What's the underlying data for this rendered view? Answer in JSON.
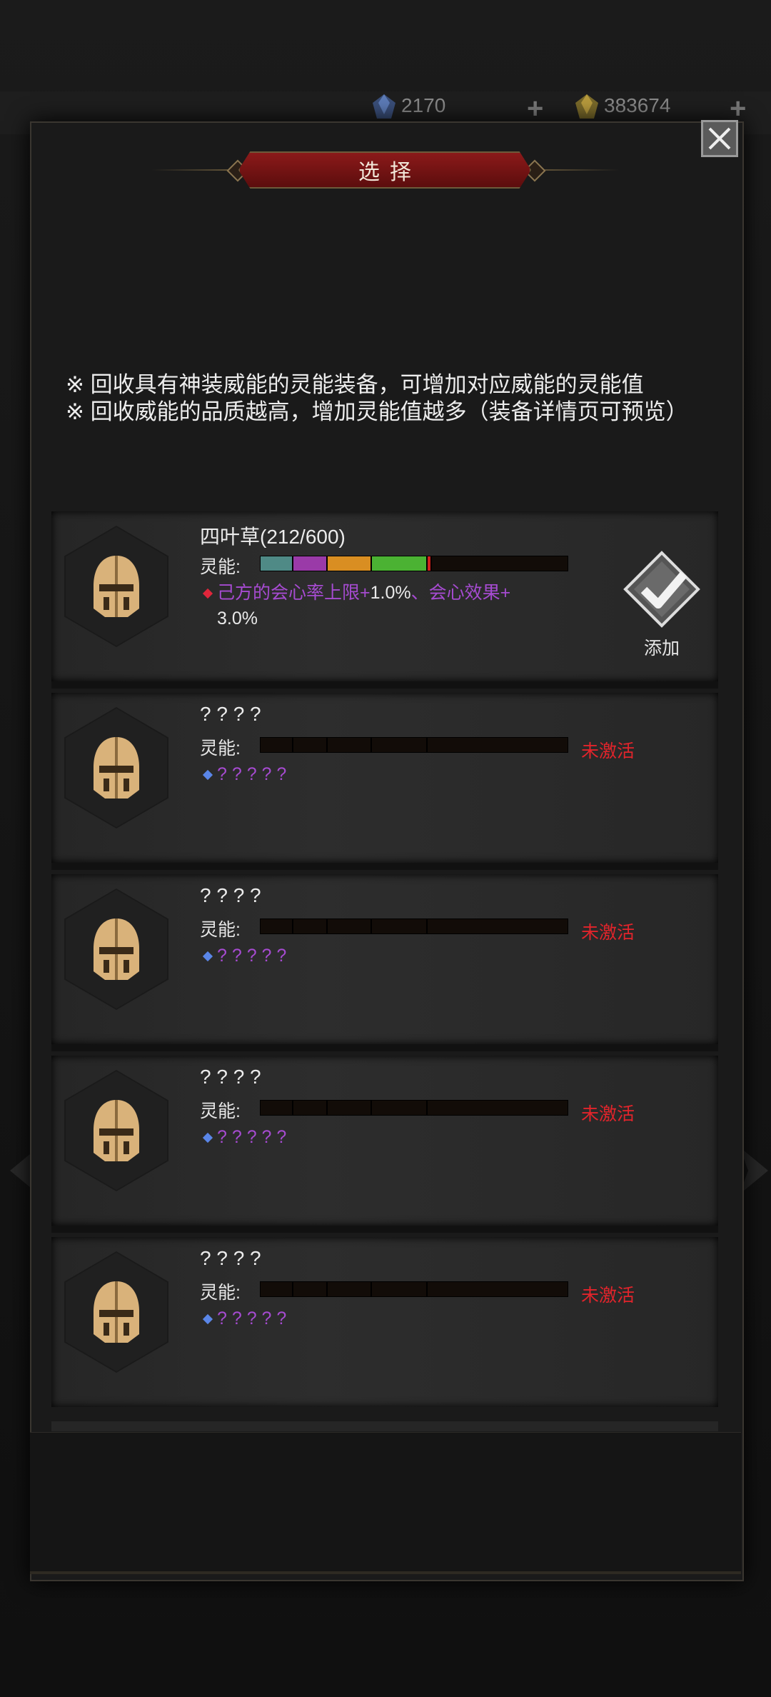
{
  "currency": [
    {
      "amount": "2170",
      "icon": "blue-gem-icon"
    },
    {
      "amount": "383674",
      "icon": "gold-gem-icon"
    }
  ],
  "modal": {
    "title": "选择",
    "notes": [
      "※ 回收具有神装威能的灵能装备，可增加对应威能的灵能值",
      "※ 回收威能的品质越高，增加灵能值越多（装备详情页可预览）"
    ]
  },
  "items": [
    {
      "name": "四叶草(212/600)",
      "ling_label": "灵能:",
      "effect_purple": "己方的会心率上限+",
      "effect_value1": "1.0%",
      "effect_mid": "、会心效果+",
      "effect_value2": "3.0%",
      "add_label": "添加"
    },
    {
      "name": "? ? ? ?",
      "ling_label": "灵能:",
      "effect": "? ? ? ? ?",
      "status": "未激活"
    },
    {
      "name": "? ? ? ?",
      "ling_label": "灵能:",
      "effect": "? ? ? ? ?",
      "status": "未激活"
    },
    {
      "name": "? ? ? ?",
      "ling_label": "灵能:",
      "effect": "? ? ? ? ?",
      "status": "未激活"
    },
    {
      "name": "? ? ? ?",
      "ling_label": "灵能:",
      "effect": "? ? ? ? ?",
      "status": "未激活"
    }
  ],
  "colors": {
    "bar_teal": "#4f8a86",
    "bar_purple": "#9a3aa8",
    "bar_orange": "#d98e22",
    "bar_green": "#4bb233",
    "bar_red": "#d0201c",
    "inactive_red": "#e2242b",
    "effect_purple": "#a64bd1"
  }
}
